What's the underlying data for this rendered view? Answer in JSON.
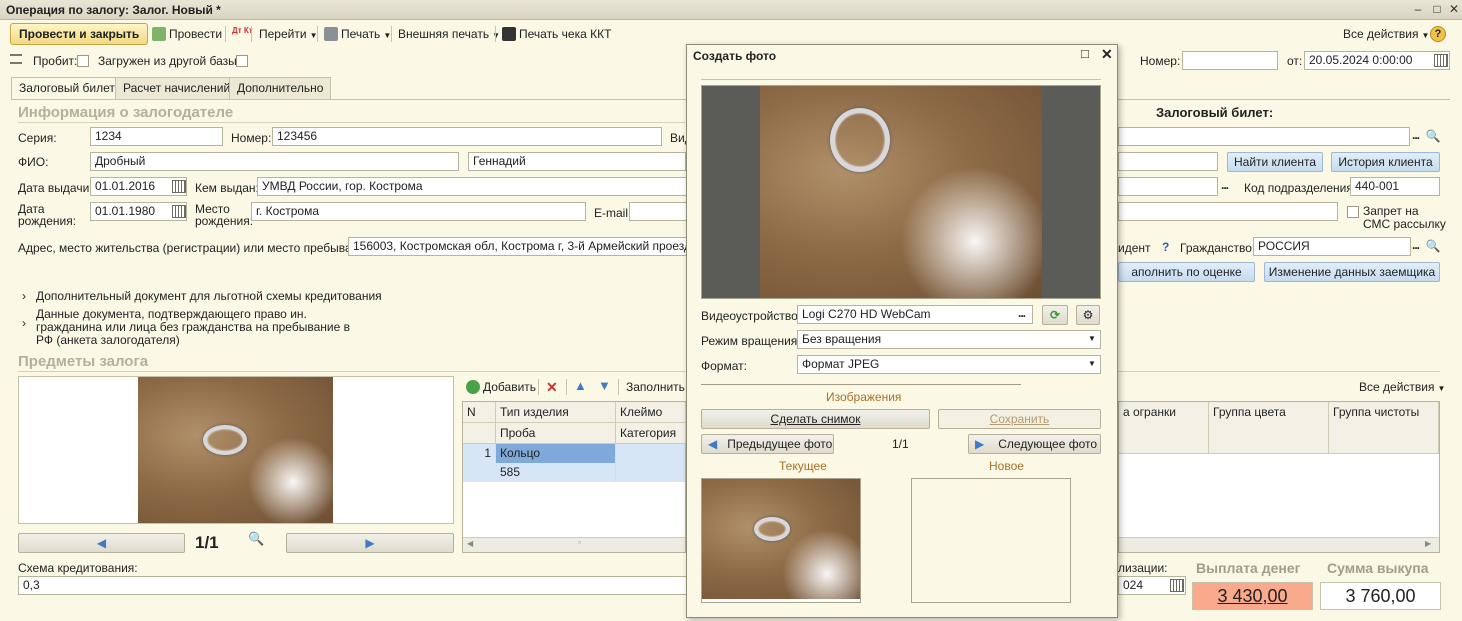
{
  "window": {
    "title": "Операция по залогу: Залог. Новый *"
  },
  "toolbar": {
    "post_close": "Провести и закрыть",
    "post": "Провести",
    "dtkt": "Дт Кт",
    "goto": "Перейти",
    "print": "Печать",
    "ext_print": "Внешняя печать",
    "receipt": "Печать чека ККТ",
    "all_actions": "Все действия",
    "help": "?"
  },
  "top_row": {
    "probit_label": "Пробит:",
    "loaded_label": "Загружен из другой базы:",
    "number_label": "Номер:",
    "number_value": "",
    "from_label": "от:",
    "date_value": "20.05.2024  0:00:00"
  },
  "tabs": [
    "Залоговый билет",
    "Расчет начислений",
    "Дополнительно"
  ],
  "pledger": {
    "section_title": "Информация о залогодателе",
    "ticket_title": "Залоговый билет:",
    "series_label": "Серия:",
    "series_value": "1234",
    "number_label": "Номер:",
    "number_value": "123456",
    "vid_label": "Вид",
    "fio_label": "ФИО:",
    "last_name": "Дробный",
    "first_name": "Геннадий",
    "issue_date_label": "Дата выдачи:",
    "issue_date": "01.01.2016",
    "issued_by_label": "Кем выдан:",
    "issued_by": "УМВД России, гор. Кострома",
    "birth_date_label": "Дата рождения:",
    "birth_date": "01.01.1980",
    "birth_place_label": "Место рождения:",
    "birth_place": "г. Кострома",
    "email_label": "E-mail:",
    "email": "",
    "address_label": "Адрес, место жительства (регистрации) или место пребывания:",
    "address": "156003, Костромская обл, Кострома г, 3-й Армейский проезд, до",
    "find_client": "Найти клиента",
    "client_history": "История клиента",
    "division_code_label": "Код подразделения:",
    "division_code": "440-001",
    "sms_label": "Запрет на СМС рассылку",
    "resident_label": "идент",
    "resident_q": "?",
    "citizenship_label": "Гражданство:",
    "citizenship": "РОССИЯ",
    "fill_by_estimate": "аполнить по оценке",
    "change_borrower": "Изменение данных заемщика",
    "extra_doc": "Дополнительный документ для льготной схемы кредитования",
    "foreign_doc": "Данные документа, подтверждающего право ин. гражданина или лица без гражданства на пребывание в РФ (анкета залогодателя)"
  },
  "pledge_items": {
    "section_title": "Предметы залога",
    "counter": "1/1",
    "add": "Добавить",
    "fill": "Заполнить",
    "all_actions": "Все действия",
    "columns_top": [
      "N",
      "Тип изделия",
      "Клеймо"
    ],
    "columns_bottom": [
      "Проба",
      "Категория"
    ],
    "right_columns": [
      "а огранки",
      "Группа цвета",
      "Группа чистоты"
    ],
    "rows": [
      {
        "n": "1",
        "type": "Кольцо",
        "proba": "585"
      }
    ],
    "scheme_label": "Схема кредитования:",
    "scheme_value": "0,3",
    "realization_label": "лизации:",
    "realization_date": "024"
  },
  "totals": {
    "payout_label": "Выплата денег",
    "payout_value": "3 430,00",
    "buyback_label": "Сумма выкупа",
    "buyback_value": "3 760,00"
  },
  "dialog": {
    "title": "Создать фото",
    "device_label": "Видеоустройство:",
    "device_value": "Logi C270 HD WebCam",
    "rotation_label": "Режим вращения:",
    "rotation_value": "Без вращения",
    "format_label": "Формат:",
    "format_value": "Формат JPEG",
    "images_label": "Изображения",
    "take_photo": "Сделать снимок",
    "save": "Сохранить",
    "prev_photo": "Предыдущее фото",
    "counter": "1/1",
    "next_photo": "Следующее фото",
    "current_label": "Текущее",
    "new_label": "Новое"
  },
  "colors": {
    "accent_yellow": "#f1d982",
    "selected_row": "#7ea9d8",
    "payout_bg": "#f9a98c"
  }
}
